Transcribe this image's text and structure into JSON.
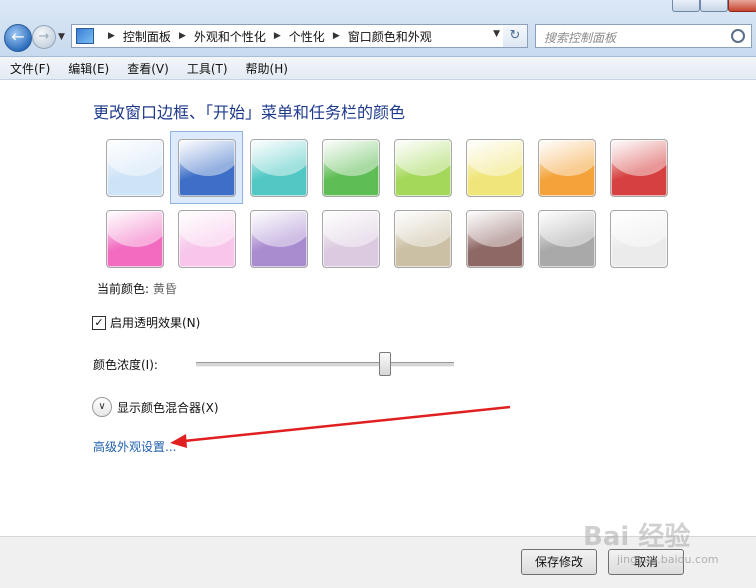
{
  "window": {
    "controls": [
      "minimize",
      "maximize",
      "close"
    ]
  },
  "nav": {
    "back_icon": "back-arrow-icon",
    "forward_icon": "forward-arrow-icon",
    "breadcrumbs": [
      "控制面板",
      "外观和个性化",
      "个性化",
      "窗口颜色和外观"
    ]
  },
  "search": {
    "placeholder": "搜索控制面板"
  },
  "menu": {
    "items": [
      "文件(F)",
      "编辑(E)",
      "查看(V)",
      "工具(T)",
      "帮助(H)"
    ]
  },
  "main": {
    "heading": "更改窗口边框、「开始」菜单和任务栏的颜色",
    "selected_swatch_index": 1,
    "swatches_row1": [
      "#cfe3f7",
      "#3d6fc8",
      "#52c8c4",
      "#5fbd55",
      "#a4d85a",
      "#f0e57a",
      "#f4a33a",
      "#d64040"
    ],
    "swatches_row2": [
      "#f26bc0",
      "#f7c6ea",
      "#a98bd0",
      "#dccbe0",
      "#cbbfa4",
      "#8e6864",
      "#a9a9a9",
      "#ebebeb"
    ],
    "current_color_label": "当前颜色:",
    "current_color_value": "黄昏",
    "transparency": {
      "label": "启用透明效果(N)",
      "checked": true
    },
    "intensity": {
      "label": "颜色浓度(I):",
      "value_fraction": 0.73
    },
    "mixer_label": "显示颜色混合器(X)",
    "advanced_link": "高级外观设置..."
  },
  "footer": {
    "save": "保存修改",
    "cancel": "取消"
  },
  "watermark": {
    "text": "Bai 经验",
    "sub": "jingyan.baidu.com"
  },
  "colors": {
    "link": "#1f5fb0",
    "heading": "#1e3a8c",
    "annotation_arrow": "#e02020"
  }
}
